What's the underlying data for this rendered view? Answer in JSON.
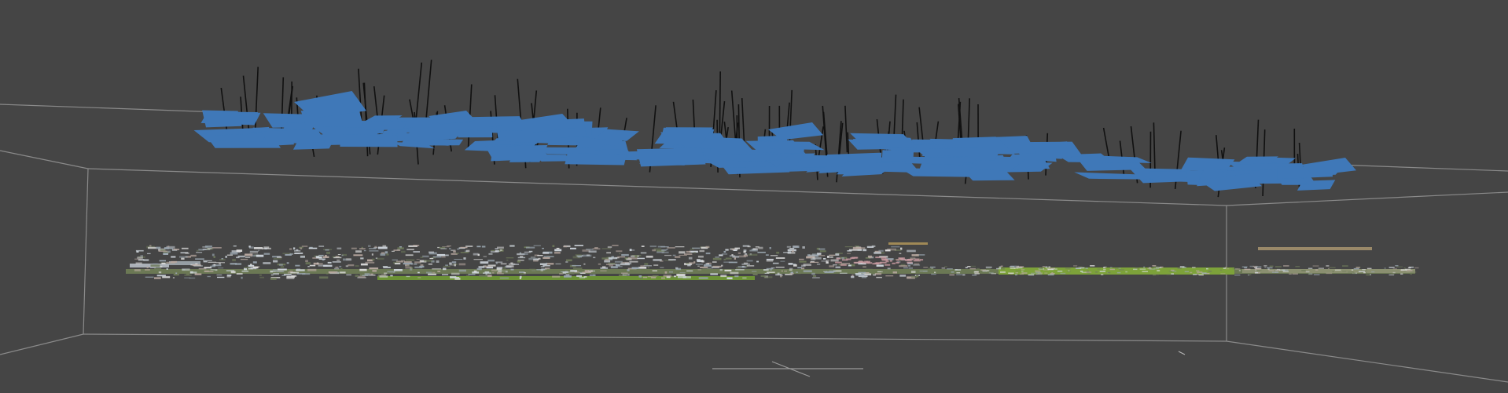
{
  "viewer": {
    "background_color": "#454545",
    "bounding_box_line_color": "#8a8a8a",
    "camera_frustum_color": "#3f78b8",
    "camera_axis_color": "#111111",
    "ground_strip_color": "#7a9a3a",
    "point_cloud_tones": [
      "#cfd6dd",
      "#9aa6b0",
      "#6e7a5a",
      "#b8a8a0",
      "#dcdcdc"
    ]
  },
  "icons": {
    "scene": "3d-viewport-icon",
    "cameras": "camera-frustum-icon",
    "points": "point-cloud-icon",
    "origin": "origin-axes-icon"
  }
}
